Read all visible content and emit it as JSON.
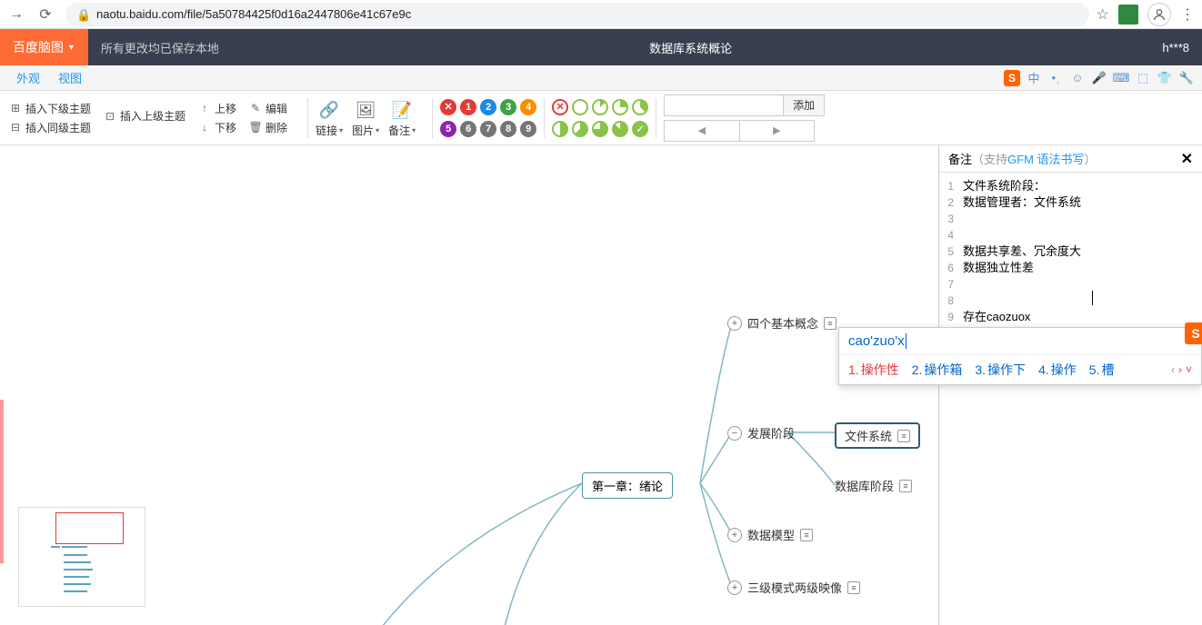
{
  "browser": {
    "url": "naotu.baidu.com/file/5a50784425f0d16a2447806e41c67e9c"
  },
  "header": {
    "logo": "百度脑图",
    "save_status": "所有更改均已保存本地",
    "title": "数据库系统概论",
    "user": "h***8"
  },
  "menubar": {
    "appearance": "外观",
    "view": "视图"
  },
  "toolbar": {
    "insert_child": "插入下级主题",
    "insert_parent": "插入上级主题",
    "insert_sibling": "插入同级主题",
    "move_up": "上移",
    "move_down": "下移",
    "edit": "编辑",
    "delete": "删除",
    "link": "链接",
    "image": "图片",
    "note": "备注",
    "add": "添加"
  },
  "mindmap": {
    "root": "第一章：绪论",
    "n1": "四个基本概念",
    "n2": "发展阶段",
    "n2a": "文件系统",
    "n2b": "数据库阶段",
    "n3": "数据模型",
    "n4": "三级模式两级映像"
  },
  "notes": {
    "title": "备注",
    "hint_pre": "（支持 ",
    "hint_link": "GFM 语法书写",
    "hint_post": "）",
    "lines": {
      "l1": "文件系统阶段：",
      "l2": "数据管理者：文件系统",
      "l5": "数据共享差、冗余度大",
      "l6": "数据独立性差",
      "l9": "存在caozuox"
    }
  },
  "ime": {
    "input": "cao'zuo'x",
    "c1": "操作性",
    "c2": "操作箱",
    "c3": "操作下",
    "c4": "操作",
    "c5": "槽"
  },
  "ime_bar": {
    "ch": "中"
  }
}
